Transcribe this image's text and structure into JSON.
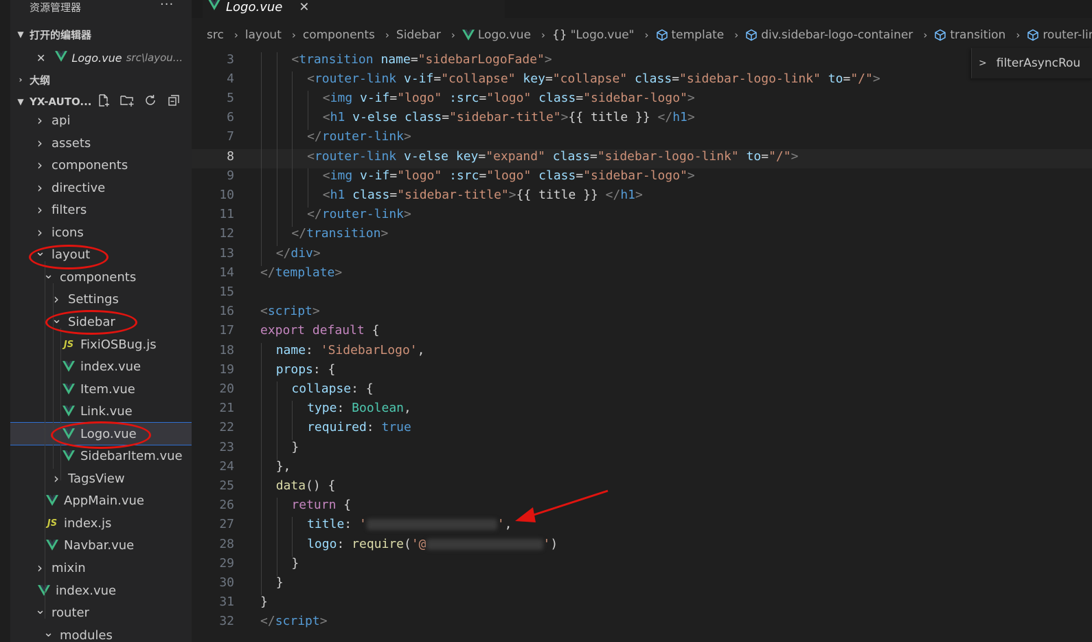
{
  "sidebar": {
    "title": "资源管理器",
    "more": "···",
    "open_editors_label": "打开的编辑器",
    "open_editor": {
      "name": "Logo.vue",
      "path": "src\\layou..."
    },
    "outline_label": "大纲",
    "workspace_label": "YX-AUTO...",
    "tree": [
      {
        "label": "api",
        "type": "folder",
        "expanded": false
      },
      {
        "label": "assets",
        "type": "folder",
        "expanded": false
      },
      {
        "label": "components",
        "type": "folder",
        "expanded": false
      },
      {
        "label": "directive",
        "type": "folder",
        "expanded": false
      },
      {
        "label": "filters",
        "type": "folder",
        "expanded": false
      },
      {
        "label": "icons",
        "type": "folder",
        "expanded": false
      },
      {
        "label": "layout",
        "type": "folder",
        "expanded": true
      },
      {
        "label": "components",
        "type": "folder",
        "expanded": true
      },
      {
        "label": "Settings",
        "type": "folder",
        "expanded": false
      },
      {
        "label": "Sidebar",
        "type": "folder",
        "expanded": true
      },
      {
        "label": "FixiOSBug.js",
        "type": "js"
      },
      {
        "label": "index.vue",
        "type": "vue"
      },
      {
        "label": "Item.vue",
        "type": "vue"
      },
      {
        "label": "Link.vue",
        "type": "vue"
      },
      {
        "label": "Logo.vue",
        "type": "vue",
        "selected": true
      },
      {
        "label": "SidebarItem.vue",
        "type": "vue"
      },
      {
        "label": "TagsView",
        "type": "folder",
        "expanded": false
      },
      {
        "label": "AppMain.vue",
        "type": "vue"
      },
      {
        "label": "index.js",
        "type": "js"
      },
      {
        "label": "Navbar.vue",
        "type": "vue"
      },
      {
        "label": "mixin",
        "type": "folder",
        "expanded": false
      },
      {
        "label": "index.vue",
        "type": "vue"
      },
      {
        "label": "router",
        "type": "folder",
        "expanded": true
      },
      {
        "label": "modules",
        "type": "folder",
        "expanded": true
      }
    ]
  },
  "tab": {
    "name": "Logo.vue",
    "close": "✕"
  },
  "breadcrumbs": [
    {
      "label": "src",
      "icon": ""
    },
    {
      "label": "layout",
      "icon": ""
    },
    {
      "label": "components",
      "icon": ""
    },
    {
      "label": "Sidebar",
      "icon": ""
    },
    {
      "label": "Logo.vue",
      "icon": "vue"
    },
    {
      "label": "\"Logo.vue\"",
      "icon": "braces"
    },
    {
      "label": "template",
      "icon": "cube"
    },
    {
      "label": "div.sidebar-logo-container",
      "icon": "cube"
    },
    {
      "label": "transition",
      "icon": "cube"
    },
    {
      "label": "router-link",
      "icon": "cube"
    }
  ],
  "outline_sticky": "filterAsyncRou",
  "editor": {
    "current_line": 8,
    "lines": [
      {
        "n": "3",
        "indent": 2,
        "tokens": [
          [
            "br",
            "<"
          ],
          [
            "tag",
            "transition"
          ],
          [
            "txt",
            " "
          ],
          [
            "attr",
            "name"
          ],
          [
            "txt",
            "="
          ],
          [
            "str",
            "\"sidebarLogoFade\""
          ],
          [
            "br",
            ">"
          ]
        ]
      },
      {
        "n": "4",
        "indent": 3,
        "tokens": [
          [
            "br",
            "<"
          ],
          [
            "tag",
            "router-link"
          ],
          [
            "txt",
            " "
          ],
          [
            "attr",
            "v-if"
          ],
          [
            "txt",
            "="
          ],
          [
            "str",
            "\"collapse\""
          ],
          [
            "txt",
            " "
          ],
          [
            "attr",
            "key"
          ],
          [
            "txt",
            "="
          ],
          [
            "str",
            "\"collapse\""
          ],
          [
            "txt",
            " "
          ],
          [
            "attr",
            "class"
          ],
          [
            "txt",
            "="
          ],
          [
            "str",
            "\"sidebar-logo-link\""
          ],
          [
            "txt",
            " "
          ],
          [
            "attr",
            "to"
          ],
          [
            "txt",
            "="
          ],
          [
            "str",
            "\"/\""
          ],
          [
            "br",
            ">"
          ]
        ]
      },
      {
        "n": "5",
        "indent": 4,
        "tokens": [
          [
            "br",
            "<"
          ],
          [
            "tag",
            "img"
          ],
          [
            "txt",
            " "
          ],
          [
            "attr",
            "v-if"
          ],
          [
            "txt",
            "="
          ],
          [
            "str",
            "\"logo\""
          ],
          [
            "txt",
            " "
          ],
          [
            "attr",
            ":src"
          ],
          [
            "txt",
            "="
          ],
          [
            "str",
            "\"logo\""
          ],
          [
            "txt",
            " "
          ],
          [
            "attr",
            "class"
          ],
          [
            "txt",
            "="
          ],
          [
            "str",
            "\"sidebar-logo\""
          ],
          [
            "br",
            ">"
          ]
        ]
      },
      {
        "n": "6",
        "indent": 4,
        "tokens": [
          [
            "br",
            "<"
          ],
          [
            "tag",
            "h1"
          ],
          [
            "txt",
            " "
          ],
          [
            "attr",
            "v-else"
          ],
          [
            "txt",
            " "
          ],
          [
            "attr",
            "class"
          ],
          [
            "txt",
            "="
          ],
          [
            "str",
            "\"sidebar-title\""
          ],
          [
            "br",
            ">"
          ],
          [
            "txt",
            "{{ title }} "
          ],
          [
            "br",
            "</"
          ],
          [
            "tag",
            "h1"
          ],
          [
            "br",
            ">"
          ]
        ]
      },
      {
        "n": "7",
        "indent": 3,
        "tokens": [
          [
            "br",
            "</"
          ],
          [
            "tag",
            "router-link"
          ],
          [
            "br",
            ">"
          ]
        ]
      },
      {
        "n": "8",
        "indent": 3,
        "tokens": [
          [
            "br",
            "<"
          ],
          [
            "tag",
            "router-link"
          ],
          [
            "txt",
            " "
          ],
          [
            "attr",
            "v-else"
          ],
          [
            "txt",
            " "
          ],
          [
            "attr",
            "key"
          ],
          [
            "txt",
            "="
          ],
          [
            "str",
            "\"expand\""
          ],
          [
            "txt",
            " "
          ],
          [
            "attr",
            "class"
          ],
          [
            "txt",
            "="
          ],
          [
            "str",
            "\"sidebar-logo-link\""
          ],
          [
            "txt",
            " "
          ],
          [
            "attr",
            "to"
          ],
          [
            "txt",
            "="
          ],
          [
            "str",
            "\"/\""
          ],
          [
            "br",
            ">"
          ]
        ]
      },
      {
        "n": "9",
        "indent": 4,
        "tokens": [
          [
            "br",
            "<"
          ],
          [
            "tag",
            "img"
          ],
          [
            "txt",
            " "
          ],
          [
            "attr",
            "v-if"
          ],
          [
            "txt",
            "="
          ],
          [
            "str",
            "\"logo\""
          ],
          [
            "txt",
            " "
          ],
          [
            "attr",
            ":src"
          ],
          [
            "txt",
            "="
          ],
          [
            "str",
            "\"logo\""
          ],
          [
            "txt",
            " "
          ],
          [
            "attr",
            "class"
          ],
          [
            "txt",
            "="
          ],
          [
            "str",
            "\"sidebar-logo\""
          ],
          [
            "br",
            ">"
          ]
        ]
      },
      {
        "n": "10",
        "indent": 4,
        "tokens": [
          [
            "br",
            "<"
          ],
          [
            "tag",
            "h1"
          ],
          [
            "txt",
            " "
          ],
          [
            "attr",
            "class"
          ],
          [
            "txt",
            "="
          ],
          [
            "str",
            "\"sidebar-title\""
          ],
          [
            "br",
            ">"
          ],
          [
            "txt",
            "{{ title }} "
          ],
          [
            "br",
            "</"
          ],
          [
            "tag",
            "h1"
          ],
          [
            "br",
            ">"
          ]
        ]
      },
      {
        "n": "11",
        "indent": 3,
        "tokens": [
          [
            "br",
            "</"
          ],
          [
            "tag",
            "router-link"
          ],
          [
            "br",
            ">"
          ]
        ]
      },
      {
        "n": "12",
        "indent": 2,
        "tokens": [
          [
            "br",
            "</"
          ],
          [
            "tag",
            "transition"
          ],
          [
            "br",
            ">"
          ]
        ]
      },
      {
        "n": "13",
        "indent": 1,
        "tokens": [
          [
            "br",
            "</"
          ],
          [
            "tag",
            "div"
          ],
          [
            "br",
            ">"
          ]
        ]
      },
      {
        "n": "14",
        "indent": 0,
        "tokens": [
          [
            "br",
            "</"
          ],
          [
            "tag",
            "template"
          ],
          [
            "br",
            ">"
          ]
        ]
      },
      {
        "n": "15",
        "indent": 0,
        "tokens": []
      },
      {
        "n": "16",
        "indent": 0,
        "tokens": [
          [
            "br",
            "<"
          ],
          [
            "tag",
            "script"
          ],
          [
            "br",
            ">"
          ]
        ]
      },
      {
        "n": "17",
        "indent": 0,
        "tokens": [
          [
            "kw",
            "export"
          ],
          [
            "txt",
            " "
          ],
          [
            "kw",
            "default"
          ],
          [
            "txt",
            " {"
          ]
        ]
      },
      {
        "n": "18",
        "indent": 1,
        "tokens": [
          [
            "prop",
            "name"
          ],
          [
            "txt",
            ": "
          ],
          [
            "str",
            "'SidebarLogo'"
          ],
          [
            "txt",
            ","
          ]
        ]
      },
      {
        "n": "19",
        "indent": 1,
        "tokens": [
          [
            "prop",
            "props"
          ],
          [
            "txt",
            ": {"
          ]
        ]
      },
      {
        "n": "20",
        "indent": 2,
        "tokens": [
          [
            "prop",
            "collapse"
          ],
          [
            "txt",
            ": {"
          ]
        ]
      },
      {
        "n": "21",
        "indent": 3,
        "tokens": [
          [
            "prop",
            "type"
          ],
          [
            "txt",
            ": "
          ],
          [
            "type",
            "Boolean"
          ],
          [
            "txt",
            ","
          ]
        ]
      },
      {
        "n": "22",
        "indent": 3,
        "tokens": [
          [
            "prop",
            "required"
          ],
          [
            "txt",
            ": "
          ],
          [
            "blue",
            "true"
          ]
        ]
      },
      {
        "n": "23",
        "indent": 2,
        "tokens": [
          [
            "txt",
            "}"
          ]
        ]
      },
      {
        "n": "24",
        "indent": 1,
        "tokens": [
          [
            "txt",
            "},"
          ]
        ]
      },
      {
        "n": "25",
        "indent": 1,
        "tokens": [
          [
            "fn",
            "data"
          ],
          [
            "txt",
            "() {"
          ]
        ]
      },
      {
        "n": "26",
        "indent": 2,
        "tokens": [
          [
            "kw",
            "return"
          ],
          [
            "txt",
            " {"
          ]
        ]
      },
      {
        "n": "27",
        "indent": 3,
        "tokens": [
          [
            "prop",
            "title"
          ],
          [
            "txt",
            ": "
          ],
          [
            "str",
            "'"
          ],
          [
            "blur",
            "190"
          ],
          [
            "str",
            "'"
          ],
          [
            "txt",
            ","
          ]
        ]
      },
      {
        "n": "28",
        "indent": 3,
        "tokens": [
          [
            "prop",
            "logo"
          ],
          [
            "txt",
            ": "
          ],
          [
            "fn",
            "require"
          ],
          [
            "txt",
            "("
          ],
          [
            "str",
            "'@"
          ],
          [
            "blur",
            "170"
          ],
          [
            "str",
            "'"
          ],
          [
            "txt",
            ")"
          ]
        ]
      },
      {
        "n": "29",
        "indent": 2,
        "tokens": [
          [
            "txt",
            "}"
          ]
        ]
      },
      {
        "n": "30",
        "indent": 1,
        "tokens": [
          [
            "txt",
            "}"
          ]
        ]
      },
      {
        "n": "31",
        "indent": 0,
        "tokens": [
          [
            "txt",
            "}"
          ]
        ]
      },
      {
        "n": "32",
        "indent": 0,
        "tokens": [
          [
            "br",
            "</"
          ],
          [
            "tag",
            "script"
          ],
          [
            "br",
            ">"
          ]
        ]
      }
    ]
  },
  "colors": {
    "annotation": "#e0140f",
    "accent": "#2f6fd2",
    "vue_green": "#41b883",
    "js_yellow": "#cbcb41"
  }
}
